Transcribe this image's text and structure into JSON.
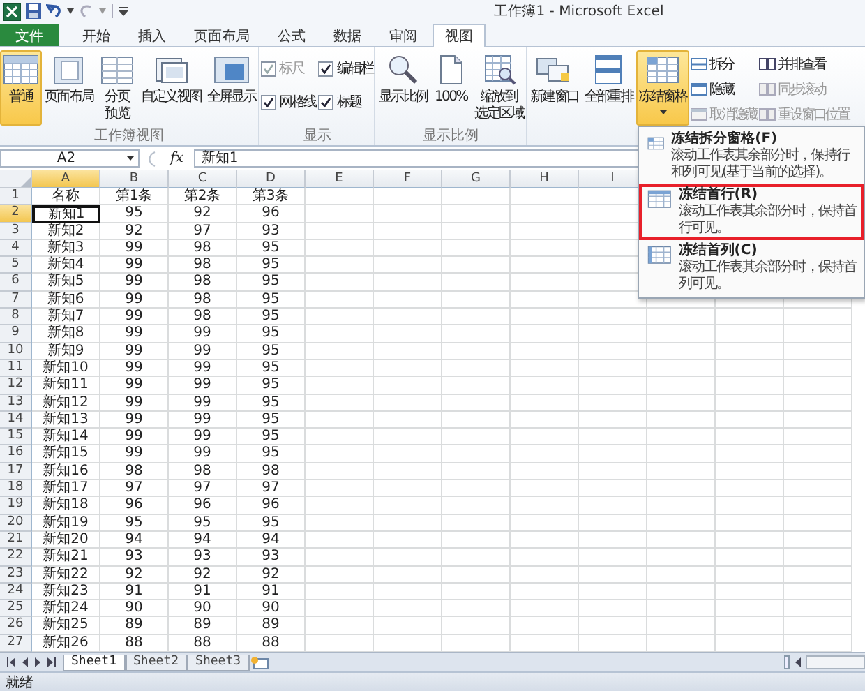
{
  "window": {
    "title": "工作簿1 - Microsoft Excel"
  },
  "tabs": [
    {
      "label": "文件",
      "kind": "file",
      "selected": false
    },
    {
      "label": "开始",
      "kind": "tab",
      "selected": false
    },
    {
      "label": "插入",
      "kind": "tab",
      "selected": false
    },
    {
      "label": "页面布局",
      "kind": "tab",
      "selected": false
    },
    {
      "label": "公式",
      "kind": "tab",
      "selected": false
    },
    {
      "label": "数据",
      "kind": "tab",
      "selected": false
    },
    {
      "label": "审阅",
      "kind": "tab",
      "selected": false
    },
    {
      "label": "视图",
      "kind": "tab",
      "selected": true
    }
  ],
  "ribbon": {
    "groups": [
      {
        "label": "工作簿视图",
        "items": [
          {
            "kind": "large",
            "label": "普通",
            "selected": true,
            "disabled": false
          },
          {
            "kind": "large",
            "label": "页面布局",
            "selected": false,
            "disabled": false
          },
          {
            "kind": "large",
            "lines": [
              "分页",
              "预览"
            ],
            "selected": false,
            "disabled": false
          },
          {
            "kind": "large",
            "label": "自定义视图",
            "selected": false,
            "disabled": false
          },
          {
            "kind": "large",
            "label": "全屏显示",
            "selected": false,
            "disabled": false
          }
        ]
      },
      {
        "label": "显示",
        "items": [
          {
            "kind": "checkbox",
            "label": "标尺",
            "checked": true,
            "disabled": true
          },
          {
            "kind": "checkbox",
            "label": "编辑栏",
            "checked": true,
            "disabled": false
          },
          {
            "kind": "checkbox",
            "label": "网格线",
            "checked": true,
            "disabled": false
          },
          {
            "kind": "checkbox",
            "label": "标题",
            "checked": true,
            "disabled": false
          }
        ]
      },
      {
        "label": "显示比例",
        "items": [
          {
            "kind": "large",
            "label": "显示比例",
            "selected": false,
            "disabled": false
          },
          {
            "kind": "large",
            "label": "100%",
            "selected": false,
            "disabled": false
          },
          {
            "kind": "large",
            "lines": [
              "缩放到",
              "选定区域"
            ],
            "selected": false,
            "disabled": false
          }
        ]
      },
      {
        "items": [
          {
            "kind": "large",
            "label": "新建窗口",
            "selected": false,
            "disabled": false
          },
          {
            "kind": "large",
            "label": "全部重排",
            "selected": false,
            "disabled": false
          },
          {
            "kind": "dropdown",
            "label": "冻结窗格",
            "selected": true,
            "disabled": false
          },
          {
            "kind": "small",
            "label": "拆分",
            "selected": false,
            "disabled": false
          },
          {
            "kind": "small",
            "label": "隐藏",
            "selected": false,
            "disabled": false
          },
          {
            "kind": "small",
            "label": "取消隐藏",
            "selected": false,
            "disabled": true
          },
          {
            "kind": "small",
            "label": "并排查看",
            "selected": false,
            "disabled": false
          },
          {
            "kind": "small",
            "label": "同步滚动",
            "selected": false,
            "disabled": true
          },
          {
            "kind": "small",
            "label": "重设窗口位置",
            "selected": false,
            "disabled": true
          }
        ]
      }
    ]
  },
  "formula_bar": {
    "name_box": "A2",
    "function_label": "fx",
    "value": "新知1"
  },
  "columns": [
    {
      "label": "A",
      "selected": true
    },
    {
      "label": "B",
      "selected": false
    },
    {
      "label": "C",
      "selected": false
    },
    {
      "label": "D",
      "selected": false
    },
    {
      "label": "E",
      "selected": false
    },
    {
      "label": "F",
      "selected": false
    },
    {
      "label": "G",
      "selected": false
    },
    {
      "label": "H",
      "selected": false
    },
    {
      "label": "I",
      "selected": false
    }
  ],
  "rows": [
    {
      "number": "1",
      "selected": false,
      "cells": [
        "名称",
        "第1条",
        "第2条",
        "第3条"
      ]
    },
    {
      "number": "2",
      "selected": true,
      "cells": [
        "新知1",
        "95",
        "92",
        "96"
      ]
    },
    {
      "number": "3",
      "selected": false,
      "cells": [
        "新知2",
        "92",
        "97",
        "93"
      ]
    },
    {
      "number": "4",
      "selected": false,
      "cells": [
        "新知3",
        "99",
        "98",
        "95"
      ]
    },
    {
      "number": "5",
      "selected": false,
      "cells": [
        "新知4",
        "99",
        "98",
        "95"
      ]
    },
    {
      "number": "6",
      "selected": false,
      "cells": [
        "新知5",
        "99",
        "98",
        "95"
      ]
    },
    {
      "number": "7",
      "selected": false,
      "cells": [
        "新知6",
        "99",
        "98",
        "95"
      ]
    },
    {
      "number": "8",
      "selected": false,
      "cells": [
        "新知7",
        "99",
        "98",
        "95"
      ]
    },
    {
      "number": "9",
      "selected": false,
      "cells": [
        "新知8",
        "99",
        "99",
        "95"
      ]
    },
    {
      "number": "10",
      "selected": false,
      "cells": [
        "新知9",
        "99",
        "99",
        "95"
      ]
    },
    {
      "number": "11",
      "selected": false,
      "cells": [
        "新知10",
        "99",
        "99",
        "95"
      ]
    },
    {
      "number": "12",
      "selected": false,
      "cells": [
        "新知11",
        "99",
        "99",
        "95"
      ]
    },
    {
      "number": "13",
      "selected": false,
      "cells": [
        "新知12",
        "99",
        "99",
        "95"
      ]
    },
    {
      "number": "14",
      "selected": false,
      "cells": [
        "新知13",
        "99",
        "99",
        "95"
      ]
    },
    {
      "number": "15",
      "selected": false,
      "cells": [
        "新知14",
        "99",
        "99",
        "95"
      ]
    },
    {
      "number": "16",
      "selected": false,
      "cells": [
        "新知15",
        "99",
        "99",
        "95"
      ]
    },
    {
      "number": "17",
      "selected": false,
      "cells": [
        "新知16",
        "98",
        "98",
        "98"
      ]
    },
    {
      "number": "18",
      "selected": false,
      "cells": [
        "新知17",
        "97",
        "97",
        "97"
      ]
    },
    {
      "number": "19",
      "selected": false,
      "cells": [
        "新知18",
        "96",
        "96",
        "96"
      ]
    },
    {
      "number": "20",
      "selected": false,
      "cells": [
        "新知19",
        "95",
        "95",
        "95"
      ]
    },
    {
      "number": "21",
      "selected": false,
      "cells": [
        "新知20",
        "94",
        "94",
        "94"
      ]
    },
    {
      "number": "22",
      "selected": false,
      "cells": [
        "新知21",
        "93",
        "93",
        "93"
      ]
    },
    {
      "number": "23",
      "selected": false,
      "cells": [
        "新知22",
        "92",
        "92",
        "92"
      ]
    },
    {
      "number": "24",
      "selected": false,
      "cells": [
        "新知23",
        "91",
        "91",
        "91"
      ]
    },
    {
      "number": "25",
      "selected": false,
      "cells": [
        "新知24",
        "90",
        "90",
        "90"
      ]
    },
    {
      "number": "26",
      "selected": false,
      "cells": [
        "新知25",
        "89",
        "89",
        "89"
      ]
    },
    {
      "number": "27",
      "selected": false,
      "cells": [
        "新知26",
        "88",
        "88",
        "88"
      ]
    }
  ],
  "sheet_tabs": [
    {
      "label": "Sheet1",
      "selected": true
    },
    {
      "label": "Sheet2",
      "selected": false
    },
    {
      "label": "Sheet3",
      "selected": false
    }
  ],
  "status_bar": {
    "text": "就绪"
  },
  "menu": {
    "items": [
      {
        "title": "冻结拆分窗格(F)",
        "description": "滚动工作表其余部分时，保持行和列可见(基于当前的选择)。",
        "highlighted": false
      },
      {
        "title": "冻结首行(R)",
        "description": "滚动工作表其余部分时，保持首行可见。",
        "highlighted": true
      },
      {
        "title": "冻结首列(C)",
        "description": "滚动工作表其余部分时，保持首列可见。",
        "highlighted": false
      }
    ]
  }
}
